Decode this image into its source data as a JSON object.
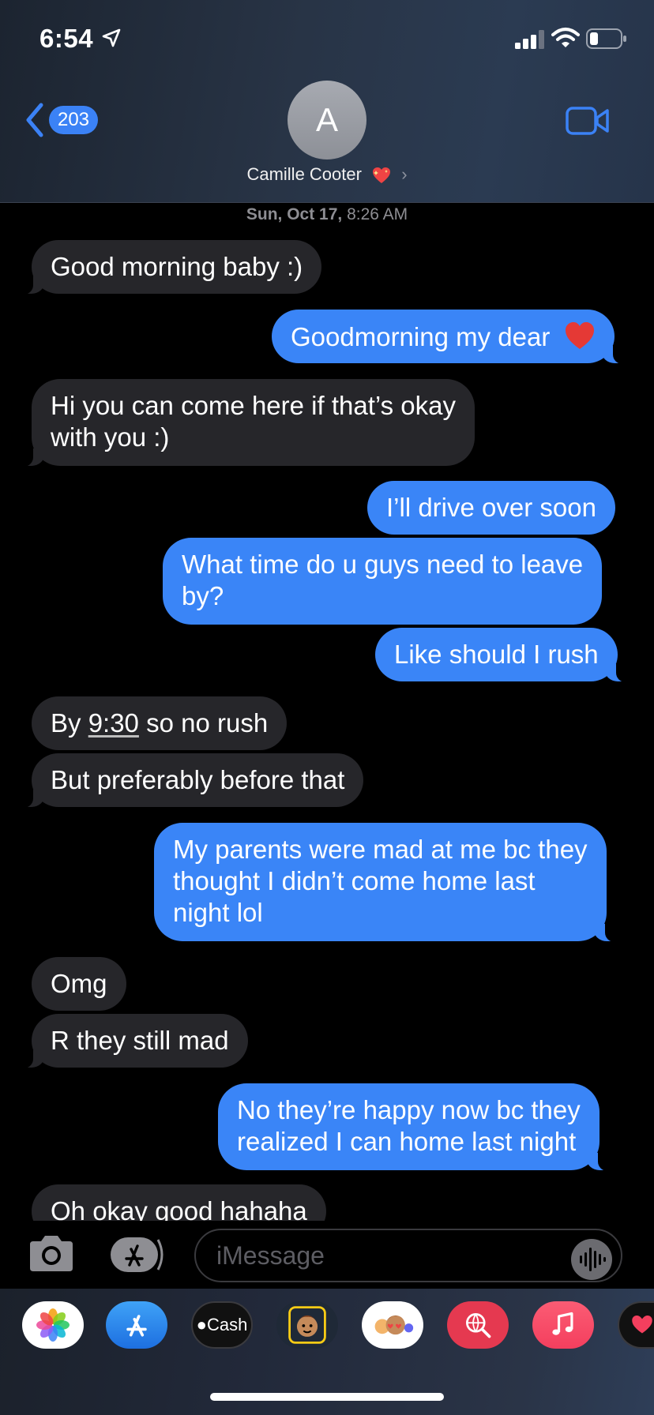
{
  "status_bar": {
    "time": "6:54",
    "icons": [
      "location-arrow-icon",
      "cellular-signal-icon",
      "wifi-icon",
      "battery-icon"
    ]
  },
  "header": {
    "back_count": "203",
    "avatar_initial": "A",
    "contact_name": "Camille Cooter",
    "contact_emoji": "sparkling-heart-icon",
    "video_icon": "video-camera-icon",
    "accent_color": "#3b82f6"
  },
  "conversation": {
    "timestamp_day": "Sun, Oct 17,",
    "timestamp_time": "8:26 AM",
    "messages": [
      {
        "from": "them",
        "text": "Good morning baby :)"
      },
      {
        "from": "me",
        "text": "Goodmorning my dear",
        "emoji": "red-heart-icon"
      },
      {
        "from": "them",
        "line1": "Hi you can come here if that’s okay",
        "line2": "with you :)"
      },
      {
        "from": "me",
        "text": "I’ll drive over soon"
      },
      {
        "from": "me",
        "line1": "What time do u guys need to leave",
        "line2": "by?"
      },
      {
        "from": "me",
        "text": "Like should I rush"
      },
      {
        "from": "them",
        "prefix": "By ",
        "link": "9:30",
        "suffix": " so no rush"
      },
      {
        "from": "them",
        "text": "But preferably before that"
      },
      {
        "from": "me",
        "line1": "My parents were mad at me bc they",
        "line2": "thought I didn’t come home last",
        "line3": "night lol"
      },
      {
        "from": "them",
        "text": "Omg"
      },
      {
        "from": "them",
        "text": "R they still mad"
      },
      {
        "from": "me",
        "line1": "No they’re happy now bc they",
        "line2": "realized I can home last night"
      },
      {
        "from": "them",
        "text": "Oh okay good hahaha"
      }
    ],
    "bubble_colors": {
      "incoming": "#26262a",
      "outgoing": "#3a85f7"
    }
  },
  "compose": {
    "placeholder": "iMessage",
    "icons": [
      "camera-icon",
      "app-store-icon",
      "audio-waveform-icon"
    ]
  },
  "app_drawer": {
    "apps": [
      {
        "name": "photos-app-icon"
      },
      {
        "name": "app-store-app-icon"
      },
      {
        "name": "apple-cash-app-icon",
        "label": "Cash"
      },
      {
        "name": "animoji-app-icon"
      },
      {
        "name": "memoji-stickers-app-icon"
      },
      {
        "name": "web-search-app-icon"
      },
      {
        "name": "music-app-icon"
      },
      {
        "name": "digital-touch-app-icon"
      }
    ]
  }
}
